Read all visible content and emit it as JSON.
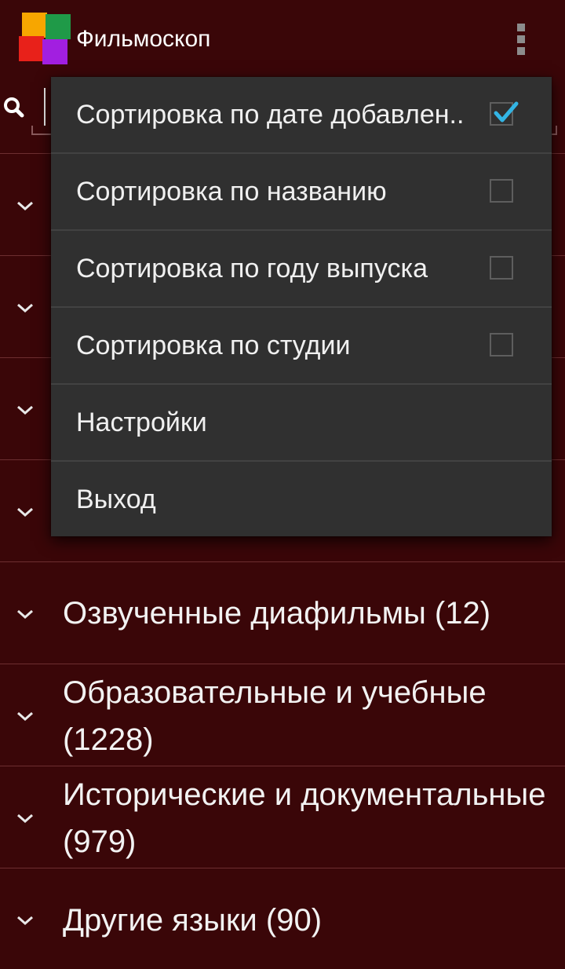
{
  "app": {
    "title": "Фильмоскоп"
  },
  "search": {
    "placeholder": "",
    "value": ""
  },
  "categories": [
    {
      "label": ""
    },
    {
      "label": ""
    },
    {
      "label": ""
    },
    {
      "label": ""
    },
    {
      "label": "Озвученные диафильмы (12)"
    },
    {
      "label": "Образовательные и учебные (1228)"
    },
    {
      "label": "Исторические и документальные (979)"
    },
    {
      "label": "Другие языки (90)"
    }
  ],
  "menu": {
    "items": [
      {
        "label": "Сортировка по дате добавлен..",
        "checkable": true,
        "checked": true
      },
      {
        "label": "Сортировка по названию",
        "checkable": true,
        "checked": false
      },
      {
        "label": "Сортировка по году выпуска",
        "checkable": true,
        "checked": false
      },
      {
        "label": "Сортировка по студии",
        "checkable": true,
        "checked": false
      },
      {
        "label": "Настройки",
        "checkable": false,
        "checked": false
      },
      {
        "label": "Выход",
        "checkable": false,
        "checked": false
      }
    ]
  },
  "colors": {
    "background": "#3a0608",
    "menu_background": "#303030",
    "divider": "#6c2e30",
    "check_accent": "#33b5e5",
    "logo_orange": "#f7a600",
    "logo_green": "#1f9a48",
    "logo_red": "#e8211a",
    "logo_purple": "#a21fe0"
  },
  "icons": {
    "search": "search-icon",
    "overflow": "overflow-menu-icon",
    "expand": "chevron-down-icon",
    "checkbox": "checkbox-icon"
  }
}
